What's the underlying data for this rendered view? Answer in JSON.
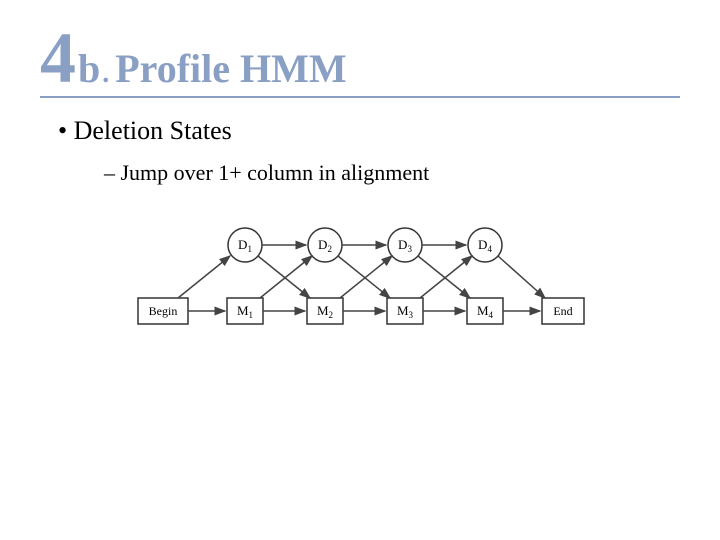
{
  "title": {
    "number": "4",
    "subletter": "b",
    "dot": ".",
    "text": "Profile HMM"
  },
  "bullets": {
    "level1": "Deletion States",
    "level2": "Jump over 1+ column in alignment"
  },
  "diagram": {
    "begin": "Begin",
    "end": "End",
    "deletion_nodes": [
      "D",
      "D",
      "D",
      "D"
    ],
    "deletion_subs": [
      "1",
      "2",
      "3",
      "4"
    ],
    "match_nodes": [
      "M",
      "M",
      "M",
      "M"
    ],
    "match_subs": [
      "1",
      "2",
      "3",
      "4"
    ]
  }
}
